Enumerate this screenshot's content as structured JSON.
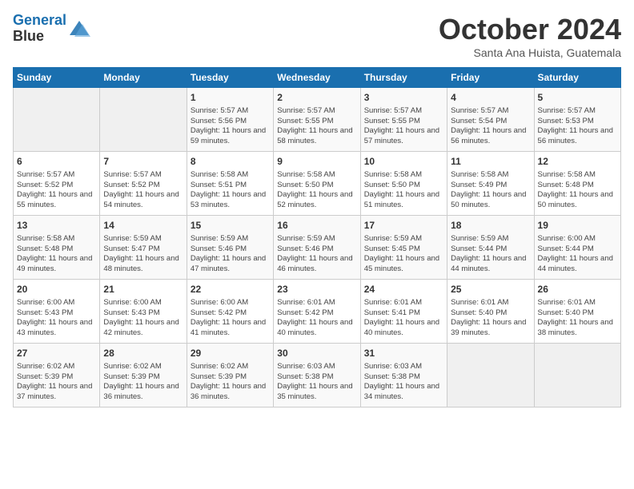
{
  "header": {
    "logo_line1": "General",
    "logo_line2": "Blue",
    "month": "October 2024",
    "location": "Santa Ana Huista, Guatemala"
  },
  "weekdays": [
    "Sunday",
    "Monday",
    "Tuesday",
    "Wednesday",
    "Thursday",
    "Friday",
    "Saturday"
  ],
  "weeks": [
    [
      {
        "day": "",
        "info": ""
      },
      {
        "day": "",
        "info": ""
      },
      {
        "day": "1",
        "info": "Sunrise: 5:57 AM\nSunset: 5:56 PM\nDaylight: 11 hours and 59 minutes."
      },
      {
        "day": "2",
        "info": "Sunrise: 5:57 AM\nSunset: 5:55 PM\nDaylight: 11 hours and 58 minutes."
      },
      {
        "day": "3",
        "info": "Sunrise: 5:57 AM\nSunset: 5:55 PM\nDaylight: 11 hours and 57 minutes."
      },
      {
        "day": "4",
        "info": "Sunrise: 5:57 AM\nSunset: 5:54 PM\nDaylight: 11 hours and 56 minutes."
      },
      {
        "day": "5",
        "info": "Sunrise: 5:57 AM\nSunset: 5:53 PM\nDaylight: 11 hours and 56 minutes."
      }
    ],
    [
      {
        "day": "6",
        "info": "Sunrise: 5:57 AM\nSunset: 5:52 PM\nDaylight: 11 hours and 55 minutes."
      },
      {
        "day": "7",
        "info": "Sunrise: 5:57 AM\nSunset: 5:52 PM\nDaylight: 11 hours and 54 minutes."
      },
      {
        "day": "8",
        "info": "Sunrise: 5:58 AM\nSunset: 5:51 PM\nDaylight: 11 hours and 53 minutes."
      },
      {
        "day": "9",
        "info": "Sunrise: 5:58 AM\nSunset: 5:50 PM\nDaylight: 11 hours and 52 minutes."
      },
      {
        "day": "10",
        "info": "Sunrise: 5:58 AM\nSunset: 5:50 PM\nDaylight: 11 hours and 51 minutes."
      },
      {
        "day": "11",
        "info": "Sunrise: 5:58 AM\nSunset: 5:49 PM\nDaylight: 11 hours and 50 minutes."
      },
      {
        "day": "12",
        "info": "Sunrise: 5:58 AM\nSunset: 5:48 PM\nDaylight: 11 hours and 50 minutes."
      }
    ],
    [
      {
        "day": "13",
        "info": "Sunrise: 5:58 AM\nSunset: 5:48 PM\nDaylight: 11 hours and 49 minutes."
      },
      {
        "day": "14",
        "info": "Sunrise: 5:59 AM\nSunset: 5:47 PM\nDaylight: 11 hours and 48 minutes."
      },
      {
        "day": "15",
        "info": "Sunrise: 5:59 AM\nSunset: 5:46 PM\nDaylight: 11 hours and 47 minutes."
      },
      {
        "day": "16",
        "info": "Sunrise: 5:59 AM\nSunset: 5:46 PM\nDaylight: 11 hours and 46 minutes."
      },
      {
        "day": "17",
        "info": "Sunrise: 5:59 AM\nSunset: 5:45 PM\nDaylight: 11 hours and 45 minutes."
      },
      {
        "day": "18",
        "info": "Sunrise: 5:59 AM\nSunset: 5:44 PM\nDaylight: 11 hours and 44 minutes."
      },
      {
        "day": "19",
        "info": "Sunrise: 6:00 AM\nSunset: 5:44 PM\nDaylight: 11 hours and 44 minutes."
      }
    ],
    [
      {
        "day": "20",
        "info": "Sunrise: 6:00 AM\nSunset: 5:43 PM\nDaylight: 11 hours and 43 minutes."
      },
      {
        "day": "21",
        "info": "Sunrise: 6:00 AM\nSunset: 5:43 PM\nDaylight: 11 hours and 42 minutes."
      },
      {
        "day": "22",
        "info": "Sunrise: 6:00 AM\nSunset: 5:42 PM\nDaylight: 11 hours and 41 minutes."
      },
      {
        "day": "23",
        "info": "Sunrise: 6:01 AM\nSunset: 5:42 PM\nDaylight: 11 hours and 40 minutes."
      },
      {
        "day": "24",
        "info": "Sunrise: 6:01 AM\nSunset: 5:41 PM\nDaylight: 11 hours and 40 minutes."
      },
      {
        "day": "25",
        "info": "Sunrise: 6:01 AM\nSunset: 5:40 PM\nDaylight: 11 hours and 39 minutes."
      },
      {
        "day": "26",
        "info": "Sunrise: 6:01 AM\nSunset: 5:40 PM\nDaylight: 11 hours and 38 minutes."
      }
    ],
    [
      {
        "day": "27",
        "info": "Sunrise: 6:02 AM\nSunset: 5:39 PM\nDaylight: 11 hours and 37 minutes."
      },
      {
        "day": "28",
        "info": "Sunrise: 6:02 AM\nSunset: 5:39 PM\nDaylight: 11 hours and 36 minutes."
      },
      {
        "day": "29",
        "info": "Sunrise: 6:02 AM\nSunset: 5:39 PM\nDaylight: 11 hours and 36 minutes."
      },
      {
        "day": "30",
        "info": "Sunrise: 6:03 AM\nSunset: 5:38 PM\nDaylight: 11 hours and 35 minutes."
      },
      {
        "day": "31",
        "info": "Sunrise: 6:03 AM\nSunset: 5:38 PM\nDaylight: 11 hours and 34 minutes."
      },
      {
        "day": "",
        "info": ""
      },
      {
        "day": "",
        "info": ""
      }
    ]
  ]
}
